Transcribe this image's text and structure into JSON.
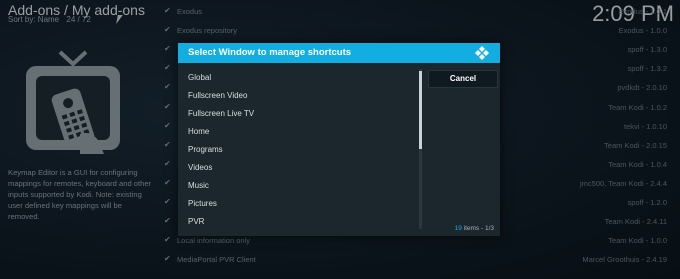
{
  "header": {
    "title": "Add-ons / My add-ons",
    "sort": "Sort by: Name",
    "position": "24 / 72",
    "clock": "2:09 PM"
  },
  "addon": {
    "description": "Keymap Editor is a GUI for configuring mappings for remotes, keyboard and other inputs supported by Kodi. Note: existing user defined key mappings will be removed."
  },
  "list": [
    {
      "name": "Exodus",
      "author": "Exodus - 1.0.1"
    },
    {
      "name": "Exodus repository",
      "author": "Exodus - 1.0.0"
    },
    {
      "name": "",
      "author": "spoff - 1.3.0"
    },
    {
      "name": "",
      "author": "spoff - 1.3.2"
    },
    {
      "name": "",
      "author": "pvdkdt - 2.0.10"
    },
    {
      "name": "",
      "author": "Team Kodi - 1.0.2"
    },
    {
      "name": "",
      "author": "tekvi - 1.0.10"
    },
    {
      "name": "",
      "author": "Team Kodi - 2.0.15"
    },
    {
      "name": "",
      "author": "Team Kodi - 1.0.4"
    },
    {
      "name": "",
      "author": "jmc500, Team Kodi - 2.4.4"
    },
    {
      "name": "",
      "author": "spoff - 1.2.0"
    },
    {
      "name": "",
      "author": "Team Kodi - 2.4.11"
    },
    {
      "name": "Local information only",
      "author": "Team Kodi - 1.0.0"
    },
    {
      "name": "MediaPortal PVR Client",
      "author": "Marcel Groothuis - 2.4.19"
    }
  ],
  "dialog": {
    "title": "Select Window to manage shortcuts",
    "cancel": "Cancel",
    "items": [
      "Global",
      "Fullscreen Video",
      "Fullscreen Live TV",
      "Home",
      "Programs",
      "Videos",
      "Music",
      "Pictures",
      "PVR"
    ],
    "count": "19",
    "count_suffix": "items - 1/3"
  }
}
